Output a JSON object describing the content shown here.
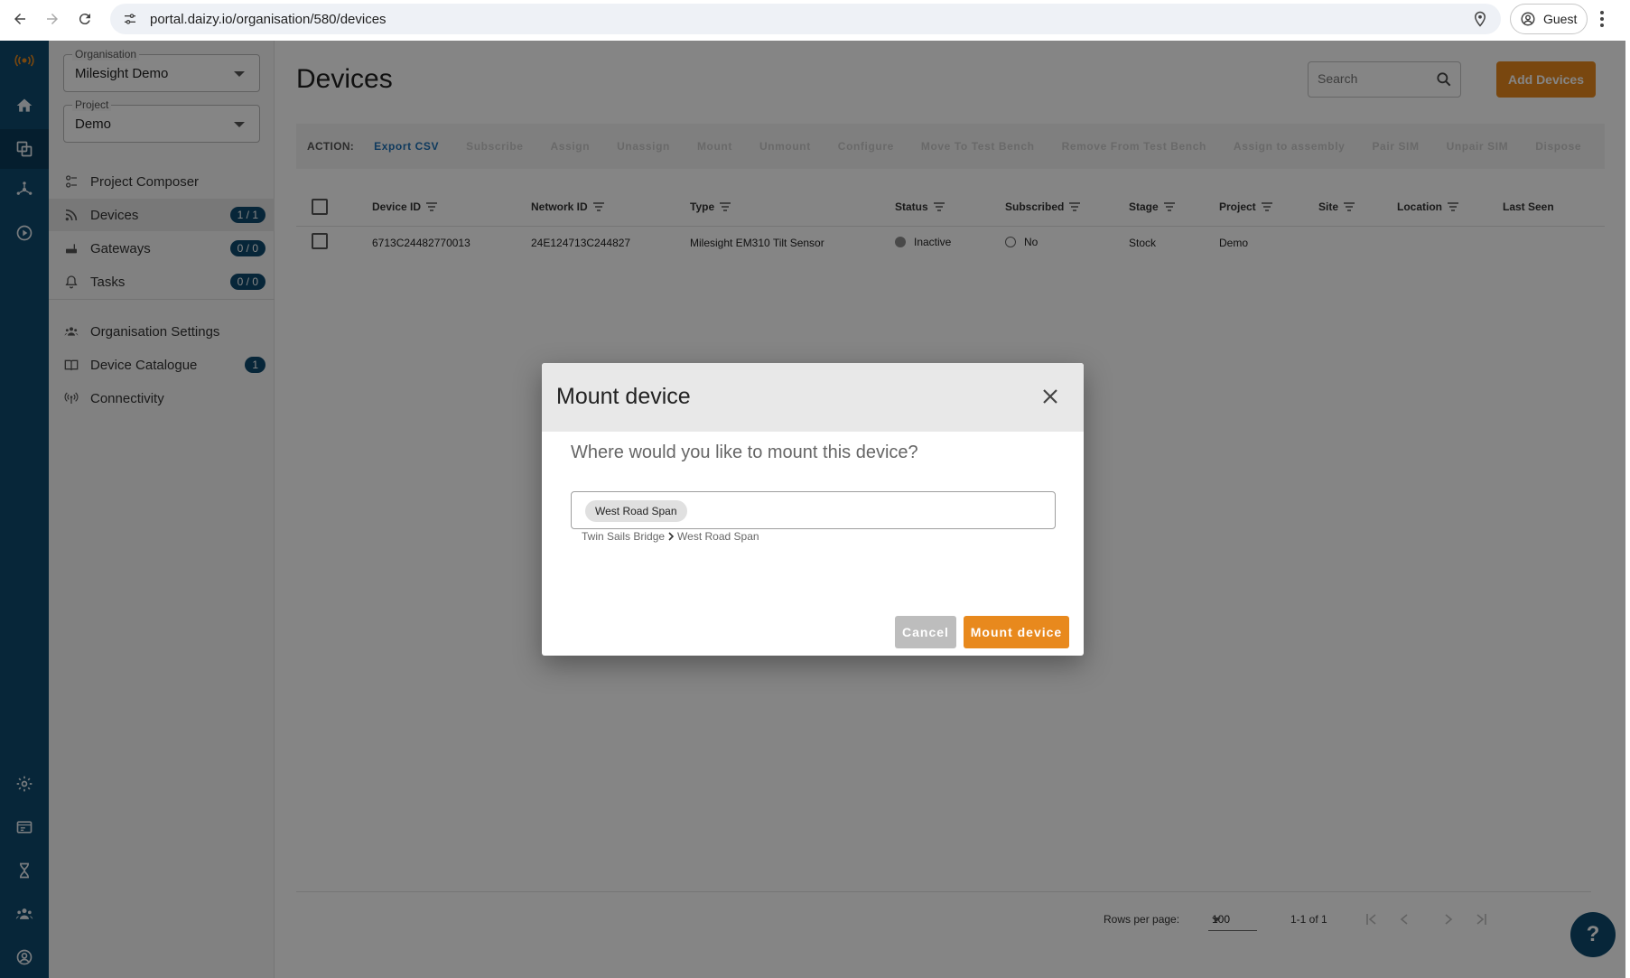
{
  "browser": {
    "url": "portal.daizy.io/organisation/580/devices",
    "profile_label": "Guest"
  },
  "sidebar": {
    "organisation": {
      "label": "Organisation",
      "value": "Milesight Demo"
    },
    "project": {
      "label": "Project",
      "value": "Demo"
    },
    "items": [
      {
        "label": "Project Composer",
        "icon": "composer-icon",
        "badge": ""
      },
      {
        "label": "Devices",
        "icon": "rss-icon",
        "badge": "1 / 1"
      },
      {
        "label": "Gateways",
        "icon": "router-icon",
        "badge": "0 / 0"
      },
      {
        "label": "Tasks",
        "icon": "bell-icon",
        "badge": "0 / 0"
      },
      {
        "label": "Organisation Settings",
        "icon": "people-icon",
        "badge": ""
      },
      {
        "label": "Device Catalogue",
        "icon": "book-icon",
        "badge": "1"
      },
      {
        "label": "Connectivity",
        "icon": "antenna-icon",
        "badge": ""
      }
    ]
  },
  "main": {
    "title": "Devices",
    "search_placeholder": "Search",
    "add_button": "Add Devices",
    "action_label": "ACTION:",
    "actions": [
      "Export CSV",
      "Subscribe",
      "Assign",
      "Unassign",
      "Mount",
      "Unmount",
      "Configure",
      "Move To Test Bench",
      "Remove From Test Bench",
      "Assign to assembly",
      "Pair SIM",
      "Unpair SIM",
      "Dispose"
    ],
    "columns": [
      "Device ID",
      "Network ID",
      "Type",
      "Status",
      "Subscribed",
      "Stage",
      "Project",
      "Site",
      "Location",
      "Last Seen"
    ],
    "rows": [
      {
        "device_id": "6713C24482770013",
        "network_id": "24E124713C244827",
        "type": "Milesight EM310 Tilt Sensor",
        "status": "Inactive",
        "subscribed": "No",
        "stage": "Stock",
        "project": "Demo",
        "site": "",
        "location": "",
        "last_seen": ""
      }
    ],
    "pagination": {
      "rows_per_page_label": "Rows per page:",
      "rows_per_page": "100",
      "range": "1-1 of 1"
    },
    "help": "?"
  },
  "dialog": {
    "title": "Mount device",
    "question": "Where would you like to mount this device?",
    "chip": "West Road Span",
    "path_root": "Twin Sails Bridge",
    "path_leaf": "West Road Span",
    "cancel": "Cancel",
    "confirm": "Mount device"
  },
  "colors": {
    "brand_navy": "#0e4a6d",
    "accent_orange": "#e8891d",
    "link_blue": "#1d6fb4"
  }
}
